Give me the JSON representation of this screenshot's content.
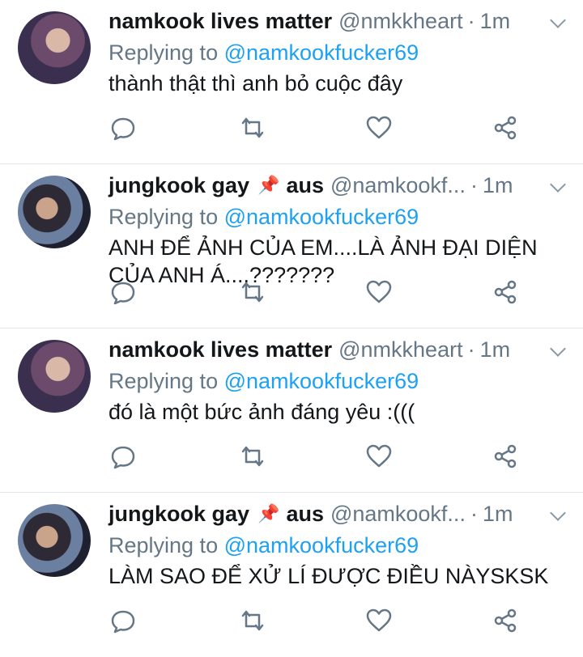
{
  "tweets": [
    {
      "name": "namkook lives matter",
      "extra": "",
      "pin": "",
      "handle": "@nmkkheart",
      "time": "1m",
      "replying_prefix": "Replying to",
      "replying_to": "@namkookfucker69",
      "text": "thành thật thì anh bỏ cuộc đây",
      "avatar": "avatar-purple"
    },
    {
      "name": "jungkook gay",
      "extra": "aus",
      "pin": "📌",
      "handle": "@namkookf...",
      "time": "1m",
      "replying_prefix": "Replying to",
      "replying_to": "@namkookfucker69",
      "text": "ANH ĐỂ ẢNH CỦA EM....LÀ ẢNH ĐẠI DIỆN CỦA ANH Á....???????",
      "avatar": "avatar-dark"
    },
    {
      "name": "namkook lives matter",
      "extra": "",
      "pin": "",
      "handle": "@nmkkheart",
      "time": "1m",
      "replying_prefix": "Replying to",
      "replying_to": "@namkookfucker69",
      "text": "đó là một bức ảnh đáng yêu :(((",
      "avatar": "avatar-purple"
    },
    {
      "name": "jungkook gay",
      "extra": "aus",
      "pin": "📌",
      "handle": "@namkookf...",
      "time": "1m",
      "replying_prefix": "Replying to",
      "replying_to": "@namkookfucker69",
      "text": "LÀM SAO ĐỂ XỬ LÍ ĐƯỢC ĐIỀU NÀYSKSK",
      "avatar": "avatar-dark"
    }
  ],
  "separator": "·",
  "colors": {
    "link": "#1da1f2",
    "muted": "#657786",
    "text": "#14171a"
  },
  "icons": [
    "reply-icon",
    "retweet-icon",
    "like-icon",
    "share-icon",
    "chevron-down-icon"
  ]
}
